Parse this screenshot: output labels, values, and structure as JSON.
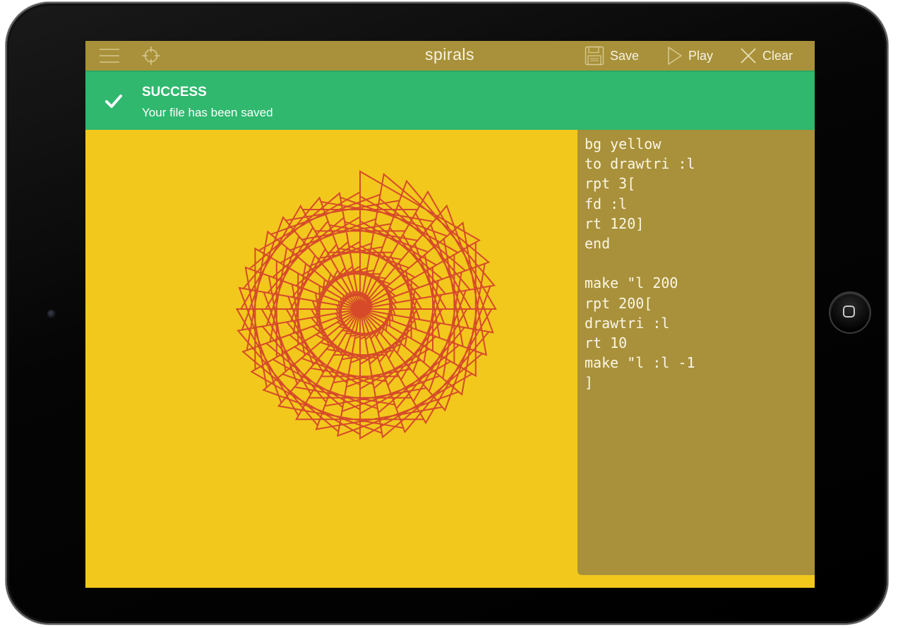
{
  "app": {
    "title": "spirals",
    "menu_icon": "menu-icon",
    "target_icon": "crosshair-icon"
  },
  "toolbar": {
    "save_label": "Save",
    "play_label": "Play",
    "clear_label": "Clear"
  },
  "notification": {
    "title": "SUCCESS",
    "message": "Your file has been saved",
    "icon": "checkmark-icon"
  },
  "editor": {
    "code": "bg yellow\nto drawtri :l\nrpt 3[\nfd :l\nrt 120]\nend\n\nmake \"l 200\nrpt 200[\ndrawtri :l\nrt 10\nmake \"l :l -1\n]"
  },
  "drawing": {
    "background": "yellow",
    "initial_length": 200,
    "repeat": 200,
    "turn": 10,
    "decrement": 1,
    "stroke_color": "#d64a2a"
  },
  "colors": {
    "toolbar": "#a8913a",
    "success": "#2fb86e",
    "canvas_bg": "#f2c81c",
    "stroke": "#d64a2a"
  }
}
